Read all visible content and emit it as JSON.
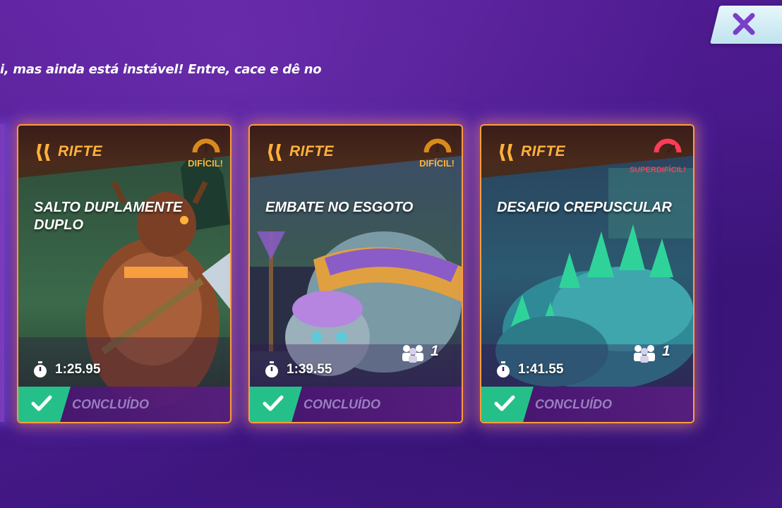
{
  "header": {
    "subtitle": "i, mas ainda está instável! Entre, cace e dê no",
    "close_icon": "close-x-icon"
  },
  "colors": {
    "background": "#4a1a8c",
    "accent_orange": "#ffb23a",
    "completed_green": "#25c08a",
    "superhard_red": "#ff3b55"
  },
  "cards": [
    {
      "category": "RIFTE",
      "difficulty": "DIFÍCIL!",
      "difficulty_color": "#ffb23a",
      "title": "SALTO DUPLAMENTE DUPLO",
      "time": "1:25.95",
      "party": "",
      "status": "CONCLUÍDO",
      "art_palette": [
        "#3d6a3e",
        "#7a4a2c"
      ]
    },
    {
      "category": "RIFTE",
      "difficulty": "DIFÍCIL!",
      "difficulty_color": "#ffb23a",
      "title": "EMBATE NO ESGOTO",
      "time": "1:39.55",
      "party": "1",
      "status": "CONCLUÍDO",
      "art_palette": [
        "#3a3f6a",
        "#8a5cc8"
      ]
    },
    {
      "category": "RIFTE",
      "difficulty": "SUPERDIFÍCIL!",
      "difficulty_color": "#ff3b55",
      "title": "DESAFIO CREPUSCULAR",
      "time": "1:41.55",
      "party": "1",
      "status": "CONCLUÍDO",
      "art_palette": [
        "#2a4f6a",
        "#2fb3a0"
      ]
    }
  ]
}
